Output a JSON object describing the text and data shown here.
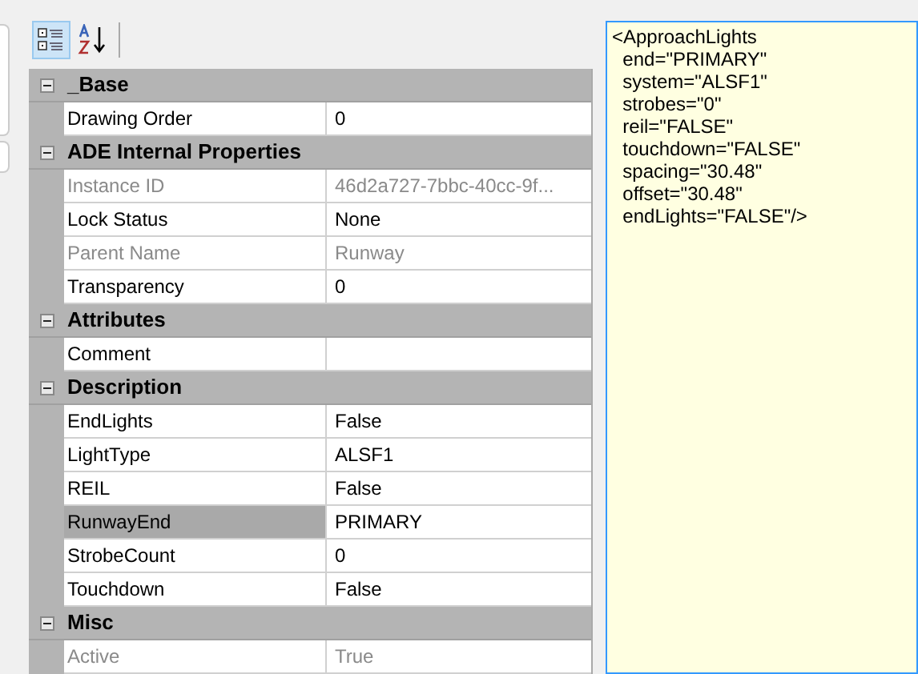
{
  "toolbar": {
    "buttons": [
      {
        "kind": "categorized",
        "selected": true
      },
      {
        "kind": "alphabetical",
        "selected": false
      }
    ]
  },
  "categories": [
    {
      "name": "_Base",
      "expanded": true,
      "properties": [
        {
          "name": "Drawing Order",
          "value": "0",
          "disabled": false,
          "selected": false
        }
      ]
    },
    {
      "name": "ADE Internal Properties",
      "expanded": true,
      "properties": [
        {
          "name": "Instance ID",
          "value": "46d2a727-7bbc-40cc-9f...",
          "disabled": true,
          "selected": false
        },
        {
          "name": "Lock Status",
          "value": "None",
          "disabled": false,
          "selected": false
        },
        {
          "name": "Parent Name",
          "value": "Runway",
          "disabled": true,
          "selected": false
        },
        {
          "name": "Transparency",
          "value": "0",
          "disabled": false,
          "selected": false
        }
      ]
    },
    {
      "name": "Attributes",
      "expanded": true,
      "properties": [
        {
          "name": "Comment",
          "disabled": false,
          "selected": false
        }
      ]
    },
    {
      "name": "Description",
      "expanded": true,
      "properties": [
        {
          "name": "EndLights",
          "value": "False",
          "disabled": false,
          "selected": false
        },
        {
          "name": "LightType",
          "value": "ALSF1",
          "disabled": false,
          "selected": false
        },
        {
          "name": "REIL",
          "value": "False",
          "disabled": false,
          "selected": false
        },
        {
          "name": "RunwayEnd",
          "value": "PRIMARY",
          "disabled": false,
          "selected": true
        },
        {
          "name": "StrobeCount",
          "value": "0",
          "disabled": false,
          "selected": false
        },
        {
          "name": "Touchdown",
          "value": "False",
          "disabled": false,
          "selected": false
        }
      ]
    },
    {
      "name": "Misc",
      "expanded": true,
      "properties": [
        {
          "name": "Active",
          "value": "True",
          "disabled": true,
          "selected": false
        }
      ]
    }
  ],
  "xml_text": [
    "<ApproachLights",
    "  end=\"PRIMARY\"",
    "  system=\"ALSF1\"",
    "  strobes=\"0\"",
    "  reil=\"FALSE\"",
    "  touchdown=\"FALSE\"",
    "  spacing=\"30.48\"",
    "  offset=\"30.48\"",
    "  endLights=\"FALSE\"/>"
  ]
}
